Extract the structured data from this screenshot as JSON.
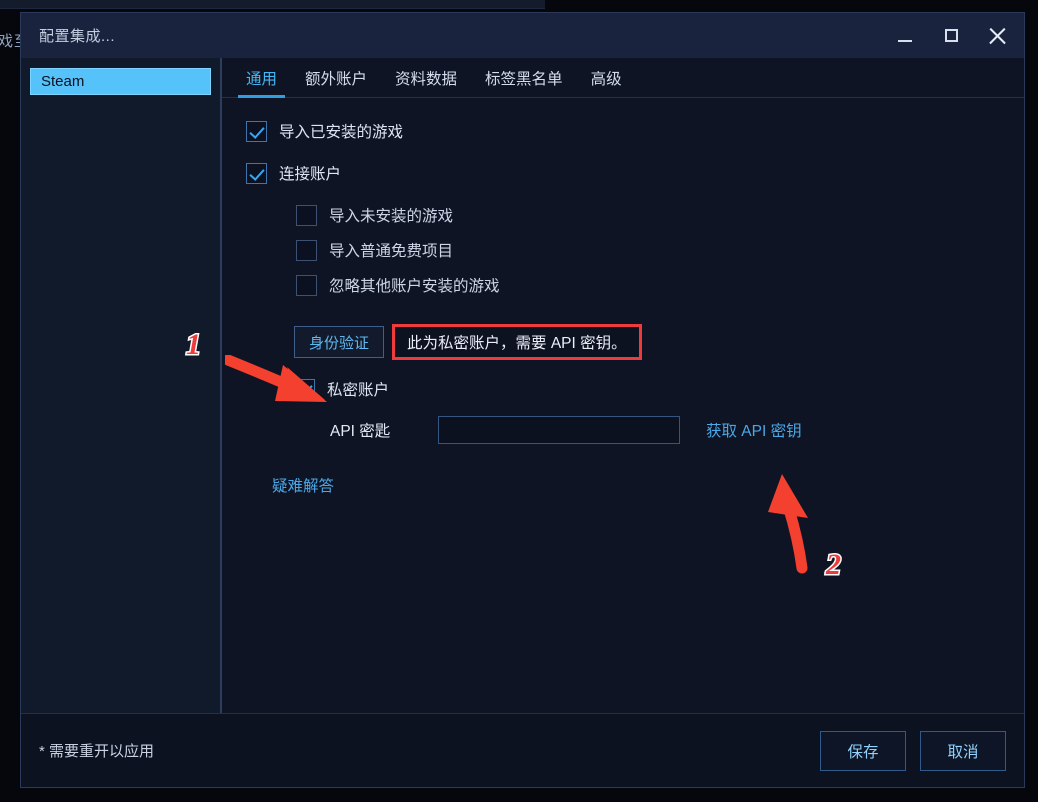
{
  "background": {
    "left_text": "戏至"
  },
  "window": {
    "title": "配置集成...",
    "controls": [
      {
        "name": "minimize",
        "icon": "minimize-icon"
      },
      {
        "name": "maximize",
        "icon": "maximize-icon"
      },
      {
        "name": "close",
        "icon": "close-icon"
      }
    ]
  },
  "sidebar": {
    "items": [
      {
        "label": "Steam",
        "active": true
      }
    ]
  },
  "tabs": [
    {
      "label": "通用",
      "active": true
    },
    {
      "label": "额外账户",
      "active": false
    },
    {
      "label": "资料数据",
      "active": false
    },
    {
      "label": "标签黑名单",
      "active": false
    },
    {
      "label": "高级",
      "active": false
    }
  ],
  "form": {
    "import_installed": {
      "label": "导入已安装的游戏",
      "checked": true
    },
    "connect_account": {
      "label": "连接账户",
      "checked": true
    },
    "sub_options": [
      {
        "label": "导入未安装的游戏",
        "checked": false
      },
      {
        "label": "导入普通免费项目",
        "checked": false
      },
      {
        "label": "忽略其他账户安装的游戏",
        "checked": false
      }
    ],
    "auth_button": "身份验证",
    "warning": "此为私密账户，需要 API 密钥。",
    "private_account": {
      "label": "私密账户",
      "checked": true
    },
    "api_key": {
      "label": "API 密匙",
      "value": "",
      "placeholder": "",
      "link": "获取 API 密钥"
    },
    "troubleshoot_link": "疑难解答"
  },
  "footer": {
    "note": "* 需要重开以应用",
    "save": "保存",
    "cancel": "取消"
  },
  "annotations": [
    {
      "label": "1",
      "target": "私密账户"
    },
    {
      "label": "2",
      "target": "获取 API 密钥"
    }
  ],
  "colors": {
    "accent": "#45b6f2",
    "highlight": "#56c2fa",
    "warning_border": "#ef3b3b",
    "annotation_red": "#ef3b3b",
    "panel_bg": "#0f1424",
    "titlebar_bg": "#1a233d",
    "sidebar_bg": "#101a2a"
  }
}
